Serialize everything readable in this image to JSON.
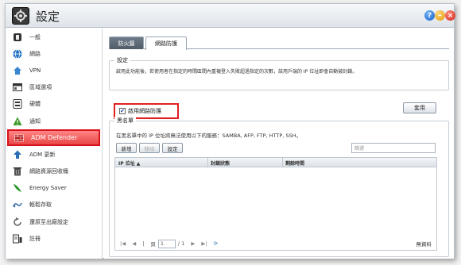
{
  "window": {
    "title": "設定"
  },
  "sidebar": {
    "items": [
      {
        "label": "一般",
        "icon": "general-icon"
      },
      {
        "label": "網路",
        "icon": "network-icon"
      },
      {
        "label": "VPN",
        "icon": "vpn-icon"
      },
      {
        "label": "區域選項",
        "icon": "regional-options-icon"
      },
      {
        "label": "硬體",
        "icon": "hardware-icon"
      },
      {
        "label": "通知",
        "icon": "notification-icon"
      },
      {
        "label": "ADM Defender",
        "icon": "adm-defender-icon"
      },
      {
        "label": "ADM 更新",
        "icon": "adm-update-icon"
      },
      {
        "label": "網路資源回收桶",
        "icon": "recycle-bin-icon"
      },
      {
        "label": "Energy Saver",
        "icon": "energy-saver-icon"
      },
      {
        "label": "輕鬆存取",
        "icon": "easy-access-icon"
      },
      {
        "label": "還原至出廠設定",
        "icon": "factory-reset-icon"
      },
      {
        "label": "註冊",
        "icon": "registration-icon"
      }
    ],
    "active_index": 6
  },
  "tabs": [
    {
      "label": "防火牆"
    },
    {
      "label": "網路防護"
    }
  ],
  "settings": {
    "legend": "設定",
    "description": "啟用此功能後，若使用者在指定的時間區間內重複登入失敗超過指定的次數，該用戶端的 IP 位址即會自動被封鎖。",
    "checkbox_label": "啟用網路防護",
    "checkbox_checked": "✔"
  },
  "apply_label": "套用",
  "blacklist": {
    "legend": "黑名單",
    "description": "在黑名單中的 IP 位址將無法使用以下的服務：SAMBA, AFP, FTP, HTTP, SSH。",
    "add_label": "新增",
    "remove_label": "移除",
    "settings_label": "設定",
    "search_placeholder": "篩選",
    "columns": [
      "IP 位址 ▲",
      "封鎖狀態",
      "剩餘時間"
    ],
    "pager": {
      "page_label": "頁",
      "page_value": "1",
      "of_label": "/ 1",
      "no_data": "無資料"
    }
  },
  "colors": {
    "active_nav": "#e94646",
    "highlight_border": "#e02020",
    "tab_inactive": "#4f5b66"
  }
}
